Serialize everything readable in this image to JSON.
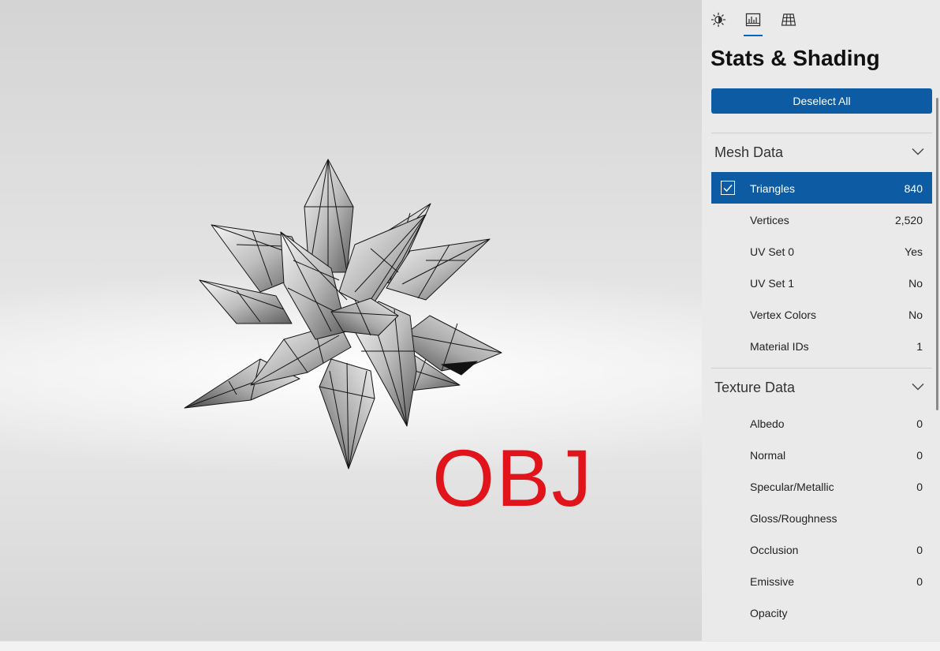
{
  "viewport": {
    "overlay_text": "OBJ",
    "overlay_color": "#e1141c"
  },
  "panel": {
    "tabs": [
      {
        "icon": "lighting-icon",
        "active": false
      },
      {
        "icon": "stats-icon",
        "active": true
      },
      {
        "icon": "grid-icon",
        "active": false
      }
    ],
    "title": "Stats & Shading",
    "deselect_label": "Deselect All",
    "accent_color": "#0d5ba3",
    "mesh_section": {
      "title": "Mesh Data",
      "rows": [
        {
          "label": "Triangles",
          "value": "840",
          "selected": true
        },
        {
          "label": "Vertices",
          "value": "2,520"
        },
        {
          "label": "UV Set 0",
          "value": "Yes"
        },
        {
          "label": "UV Set 1",
          "value": "No"
        },
        {
          "label": "Vertex Colors",
          "value": "No"
        },
        {
          "label": "Material IDs",
          "value": "1"
        }
      ]
    },
    "texture_section": {
      "title": "Texture Data",
      "rows": [
        {
          "label": "Albedo",
          "value": "0"
        },
        {
          "label": "Normal",
          "value": "0"
        },
        {
          "label": "Specular/Metallic",
          "value": "0"
        },
        {
          "label": "Gloss/Roughness",
          "value": ""
        },
        {
          "label": "Occlusion",
          "value": "0"
        },
        {
          "label": "Emissive",
          "value": "0"
        },
        {
          "label": "Opacity",
          "value": ""
        }
      ]
    }
  }
}
